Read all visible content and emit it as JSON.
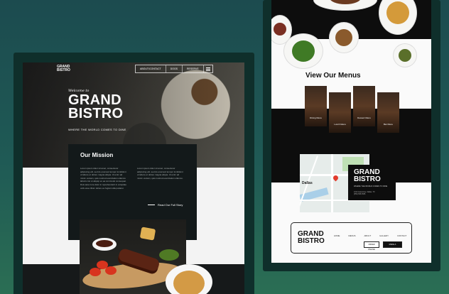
{
  "left_site": {
    "nav": {
      "logo": "GRAND\nBISTRO",
      "links": [
        "ABOUT/CONTACT",
        "DOGS",
        "RESERVE"
      ]
    },
    "hero": {
      "welcome": "Welcome to",
      "title_line1": "GRAND",
      "title_line2": "BISTRO",
      "tagline": "WHERE THE WORLD COMES TO DINE"
    },
    "mission": {
      "title": "Our Mission",
      "col1": "Lorem ipsum dolor sit amet, consectetur adipiscing elit, sed do eiusmod tempor incididunt ut labore et dolore magna aliqua. Ut enim ad minim veniam, quis nostrud exercitation ullamco laboris nisi ut aliquip ex ea commodo consequat. Duis aute irure dolor in reprehenderit in voluptate velit esse cillum dolore eu fugiat nulla pariatur.",
      "col2": "Lorem ipsum dolor sit amet, consectetur adipiscing elit, sed do eiusmod tempor incididunt ut labore et dolore magna aliqua. Ut enim ad minim veniam, quis nostrud exercitation ullamco.",
      "cta": "Read Our Full Story"
    }
  },
  "right_site": {
    "menus_title": "View Our Menus",
    "menus": [
      "Dining Menu",
      "Lunch Menu",
      "Dessert Menu",
      "Bar Menu"
    ],
    "map_city": "Dallas",
    "brand": {
      "name_line1": "GRAND",
      "name_line2": "BISTRO",
      "tagline": "WHERE THE WORLD COMES TO DINE",
      "info_line1": "1010 Grand Ave, Dallas, TX",
      "info_line2": "(555) 555-5555"
    },
    "footer": {
      "logo_line1": "GRAND",
      "logo_line2": "BISTRO",
      "links": [
        "HOME",
        "MENUS",
        "ABOUT",
        "GALLERY",
        "CONTACT"
      ],
      "btn_light": "ORDER ONLINE",
      "btn_dark": "MAKE A RESERVATION"
    }
  },
  "colors": {
    "background_teal": "#1f5a55",
    "frame": "#0f2f2b",
    "dark_panel": "#13191a",
    "accent_black": "#0d0d0d"
  }
}
